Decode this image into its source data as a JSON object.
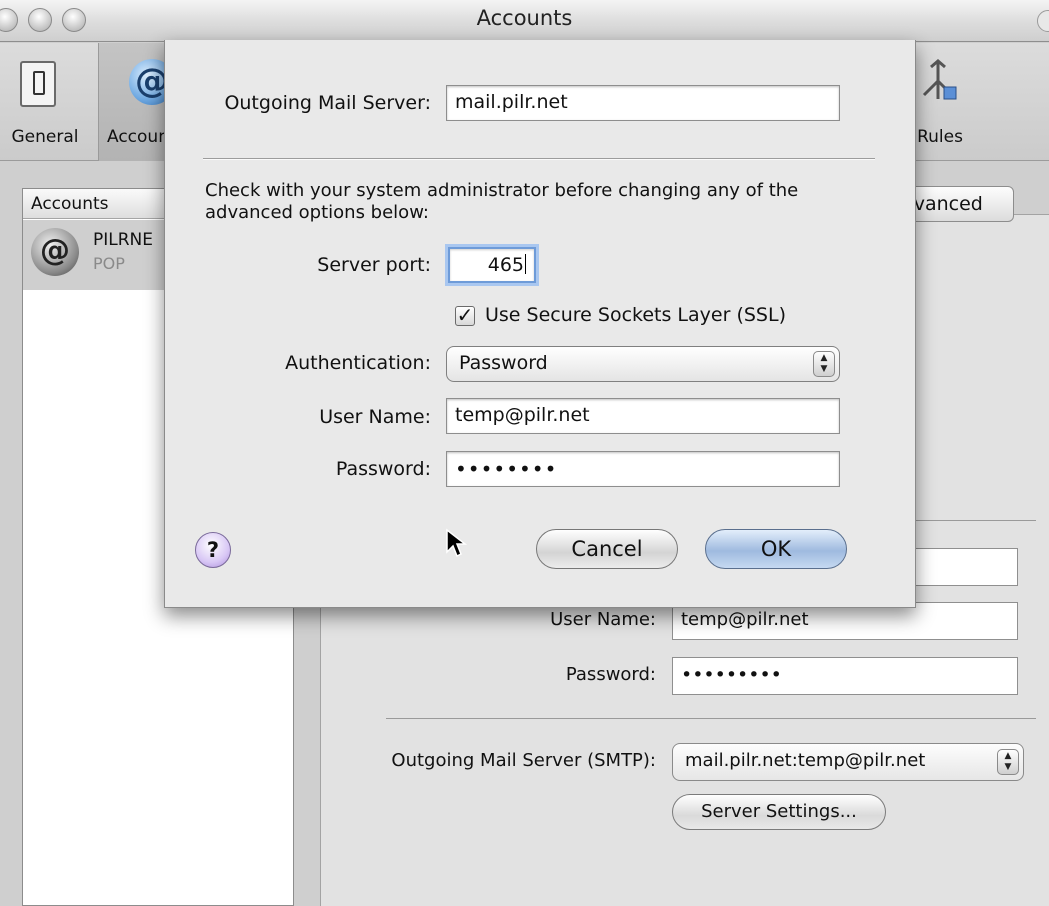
{
  "window": {
    "title": "Accounts"
  },
  "toolbar": {
    "items": [
      {
        "label": "General",
        "icon": "general-switch-icon"
      },
      {
        "label": "Accounts",
        "icon": "at-sign-icon"
      },
      {
        "label": "Rules",
        "icon": "rules-icon"
      }
    ]
  },
  "accounts_list": {
    "header": "Accounts",
    "rows": [
      {
        "name": "PILRNE",
        "type": "POP"
      }
    ]
  },
  "background": {
    "tab_advanced_label": "Advanced",
    "user_name_label": "User Name:",
    "user_name_value": "temp@pilr.net",
    "password_label": "Password:",
    "password_value": "•••••••••",
    "smtp_label": "Outgoing Mail Server (SMTP):",
    "smtp_value": "mail.pilr.net:temp@pilr.net",
    "server_settings_button": "Server Settings..."
  },
  "sheet": {
    "outgoing_server_label": "Outgoing Mail Server:",
    "outgoing_server_value": "mail.pilr.net",
    "note": "Check with your system administrator before changing any of the advanced options below:",
    "server_port_label": "Server port:",
    "server_port_value": "465",
    "ssl_label": "Use Secure Sockets Layer (SSL)",
    "ssl_checked": true,
    "auth_label": "Authentication:",
    "auth_value": "Password",
    "user_name_label": "User Name:",
    "user_name_value": "temp@pilr.net",
    "password_label": "Password:",
    "password_value": "••••••••",
    "help_label": "?",
    "cancel_label": "Cancel",
    "ok_label": "OK"
  },
  "colors": {
    "ok_button": "#9fbadf",
    "focus_ring": "#a9c7f0",
    "help_button": "#d8c7f5"
  }
}
